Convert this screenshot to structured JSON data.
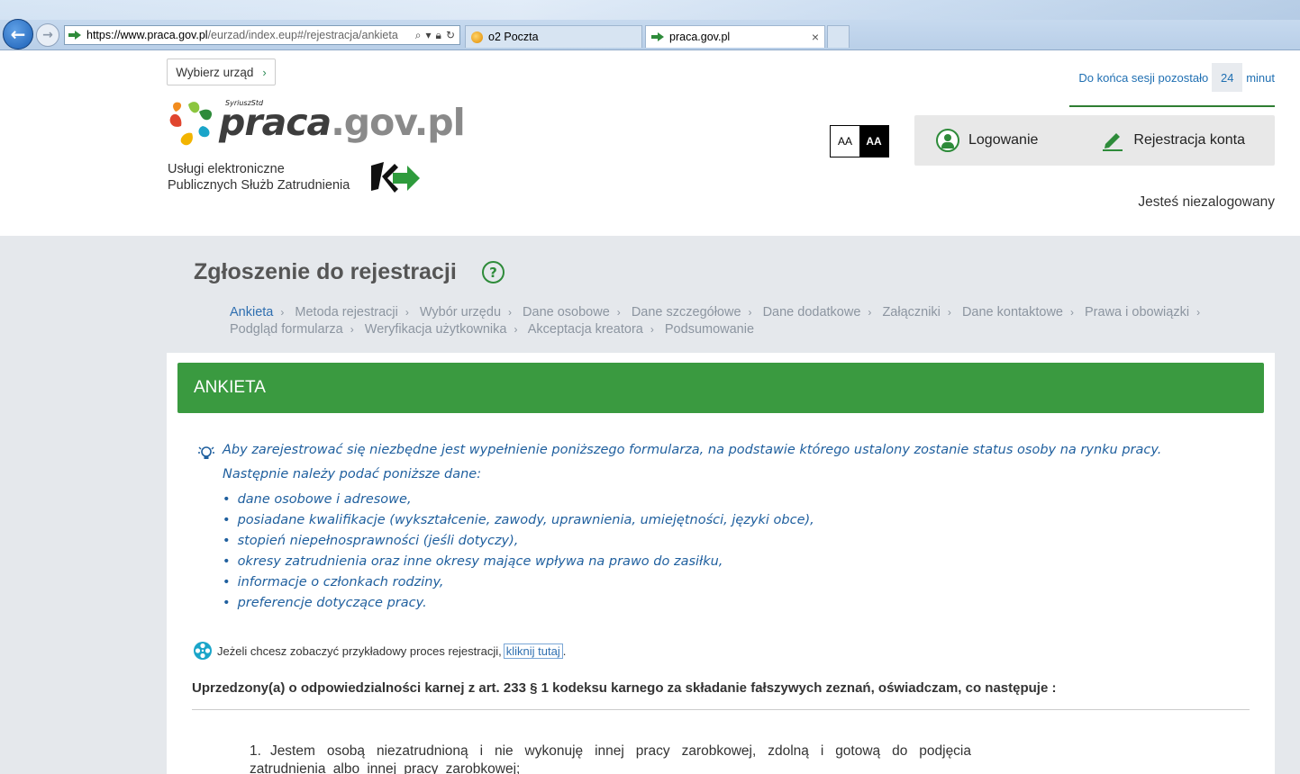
{
  "browser": {
    "url_host": "https://www.praca.gov.pl",
    "url_rest": "/eurzad/index.eup#/rejestracja/ankieta",
    "tabs": [
      {
        "label": "o2 Poczta"
      },
      {
        "label": "praca.gov.pl"
      }
    ],
    "close_glyph": "×"
  },
  "header": {
    "office_button": "Wybierz urząd",
    "office_chevron": "›",
    "logo_sup": "SyriuszStd",
    "logo_praca": "praca",
    "logo_gov": ".gov.pl",
    "tagline_1": "Usługi elektroniczne",
    "tagline_2": "Publicznych Służb Zatrudnienia",
    "session_prefix": "Do końca sesji pozostało",
    "session_minutes": "24",
    "session_suffix": "minut",
    "font_small": "AA",
    "font_large": "AA",
    "login": "Logowanie",
    "register": "Rejestracja konta",
    "status": "Jesteś niezalogowany",
    "accent_color": "#2e8b3a"
  },
  "main": {
    "title": "Zgłoszenie do rejestracji",
    "help_glyph": "?",
    "steps": [
      "Ankieta",
      "Metoda rejestracji",
      "Wybór urzędu",
      "Dane osobowe",
      "Dane szczegółowe",
      "Dane dodatkowe",
      "Załączniki",
      "Dane kontaktowe",
      "Prawa i obowiązki",
      "Podgląd formularza",
      "Weryfikacja użytkownika",
      "Akceptacja kreatora",
      "Podsumowanie"
    ],
    "step_sep": "›",
    "section_title": "ANKIETA",
    "info_line1": "Aby zarejestrować się niezbędne jest wypełnienie poniższego formularza, na podstawie którego ustalony zostanie status osoby na rynku pracy.",
    "info_line2": "Następnie należy podać poniższe dane:",
    "info_items": [
      "dane osobowe i adresowe,",
      "posiadane kwalifikacje (wykształcenie, zawody, uprawnienia, umiejętności, języki obce),",
      "stopień niepełnosprawności (jeśli dotyczy),",
      "okresy zatrudnienia oraz inne okresy mające wpływa na prawo do zasiłku,",
      "informacje o członkach rodziny,",
      "preferencje dotyczące pracy."
    ],
    "example_text": "Jeżeli chcesz zobaczyć przykładowy proces rejestracji,",
    "example_link": "kliknij tutaj",
    "example_end": ".",
    "warning": "Uprzedzony(a) o odpowiedzialności karnej z art. 233 § 1 kodeksu karnego za składanie fałszywych zeznań, oświadczam, co następuje :",
    "declaration_num": "1.",
    "declaration_text": "Jestem osobą niezatrudnioną i nie wykonuję innej pracy zarobkowej, zdolną i gotową do podjęcia zatrudnienia albo innej pracy zarobkowej;",
    "bar_color": "#3a9a40",
    "info_color": "#1f5f9e"
  }
}
